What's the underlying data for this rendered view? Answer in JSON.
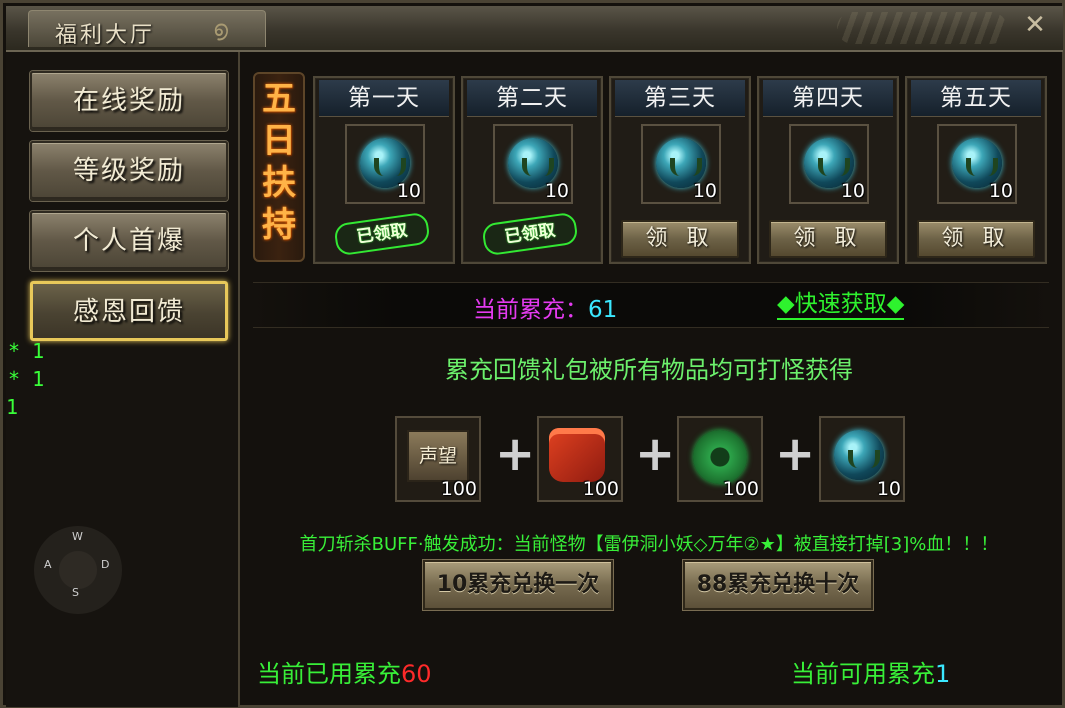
{
  "window": {
    "title": "福利大厅",
    "close_label": "✕"
  },
  "nav": {
    "items": [
      {
        "label": "在线奖励"
      },
      {
        "label": "等级奖励"
      },
      {
        "label": "个人首爆"
      },
      {
        "label": "感恩回馈",
        "active": true
      }
    ]
  },
  "dpad": {
    "up": "W",
    "left": "A",
    "right": "D",
    "down": "S"
  },
  "side_markers": [
    "* 1",
    "* 1",
    "1"
  ],
  "banner": {
    "chars": [
      "五",
      "日",
      "扶",
      "持"
    ]
  },
  "days": [
    {
      "title": "第一天",
      "item": "orb-icon",
      "count": "10",
      "status": "claimed",
      "status_label": "已领取"
    },
    {
      "title": "第二天",
      "item": "orb-icon",
      "count": "10",
      "status": "claimed",
      "status_label": "已领取"
    },
    {
      "title": "第三天",
      "item": "orb-icon",
      "count": "10",
      "status": "claimable",
      "status_label": "领 取"
    },
    {
      "title": "第四天",
      "item": "orb-icon",
      "count": "10",
      "status": "claimable",
      "status_label": "领 取"
    },
    {
      "title": "第五天",
      "item": "orb-icon",
      "count": "10",
      "status": "claimable",
      "status_label": "领 取"
    }
  ],
  "charge": {
    "label": "当前累充：",
    "value": "61"
  },
  "quick_get": "◆快速获取◆",
  "info": "累充回馈礼包被所有物品均可打怪获得",
  "rewards": [
    {
      "icon": "prestige-icon",
      "icon_text": "声望",
      "count": "100"
    },
    {
      "icon": "red-bag-icon",
      "count": "100"
    },
    {
      "icon": "jade-dragon-icon",
      "count": "100"
    },
    {
      "icon": "orb-icon",
      "count": "10"
    }
  ],
  "plus_symbol": "+",
  "notice": "首刀斩杀BUFF·触发成功：当前怪物【雷伊洞小妖◇万年②★】被直接打掉[3]%血！！！",
  "buttons": {
    "exchange_once": "10累充兑换一次",
    "exchange_ten": "88累充兑换十次"
  },
  "footer": {
    "used_label": "当前已用累充",
    "used_value": "60",
    "available_label": "当前可用累充",
    "available_value": "1"
  },
  "colors": {
    "accent_gold": "#e8c85a",
    "green_text": "#38ef38",
    "magenta_text": "#e43bf0",
    "cyan_value": "#3be8ff",
    "red_value": "#ff2a2a"
  }
}
